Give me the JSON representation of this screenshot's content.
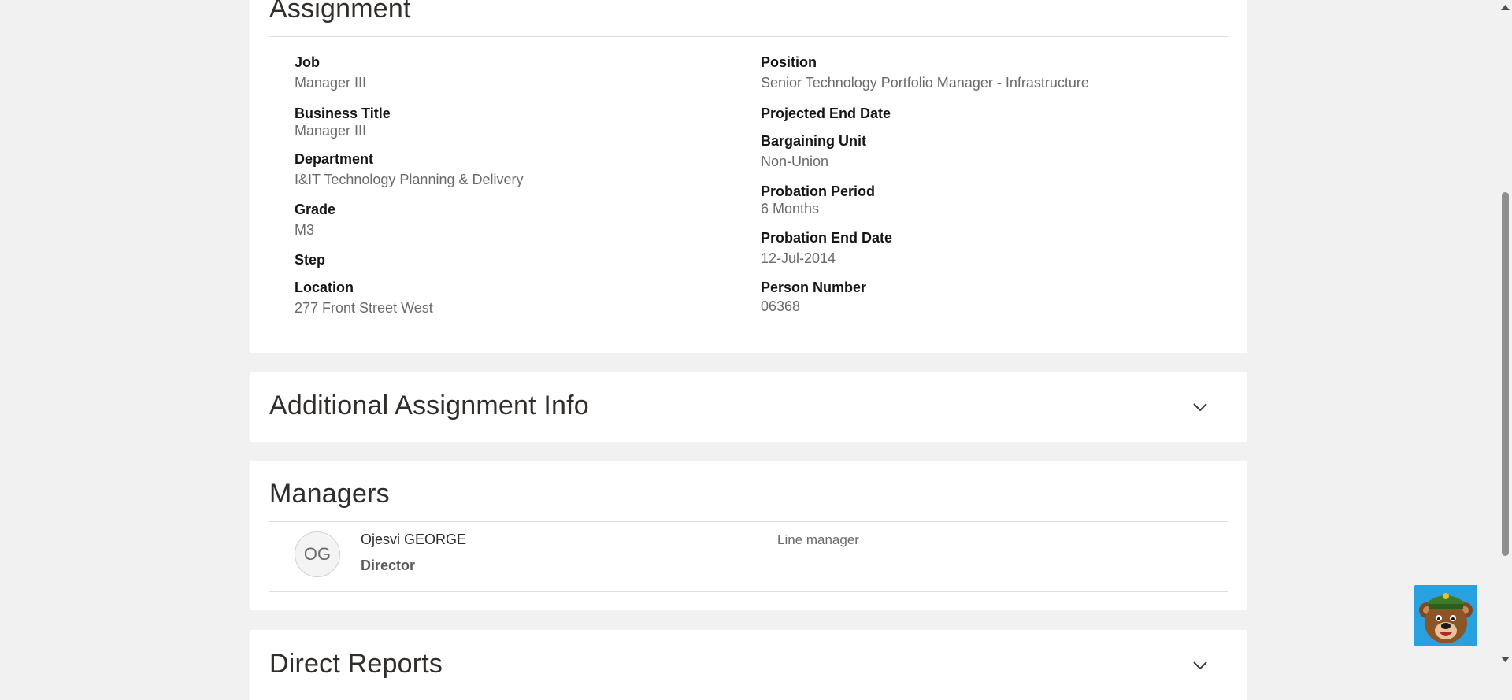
{
  "assignment": {
    "title": "Assignment",
    "left": [
      {
        "label": "Job",
        "value": "Manager III"
      },
      {
        "label": "Business Title",
        "value": "Manager III"
      },
      {
        "label": "Department",
        "value": "I&IT Technology Planning & Delivery"
      },
      {
        "label": "Grade",
        "value": "M3"
      },
      {
        "label": "Step",
        "value": ""
      },
      {
        "label": "Location",
        "value": "277 Front Street West"
      }
    ],
    "right": [
      {
        "label": "Position",
        "value": "Senior Technology Portfolio Manager - Infrastructure"
      },
      {
        "label": "Projected End Date",
        "value": ""
      },
      {
        "label": "Bargaining Unit",
        "value": "Non-Union"
      },
      {
        "label": "Probation Period",
        "value": "6 Months"
      },
      {
        "label": "Probation End Date",
        "value": "12-Jul-2014"
      },
      {
        "label": "Person Number",
        "value": "06368"
      }
    ]
  },
  "additional": {
    "title": "Additional Assignment Info",
    "chevron_icon": "chevron-down-icon"
  },
  "managers": {
    "title": "Managers",
    "items": [
      {
        "initials": "OG",
        "name": "Ojesvi GEORGE",
        "role": "Director",
        "relationship": "Line manager"
      }
    ]
  },
  "direct_reports": {
    "title": "Direct Reports",
    "chevron_icon": "chevron-down-icon"
  },
  "assistant": {
    "icon": "bear-mascot-icon"
  },
  "colors": {
    "page_bg": "#f1f1f1",
    "panel_bg": "#ffffff",
    "label": "#161513",
    "value": "#6a6a6a",
    "mascot_bg": "#29a0e0"
  }
}
